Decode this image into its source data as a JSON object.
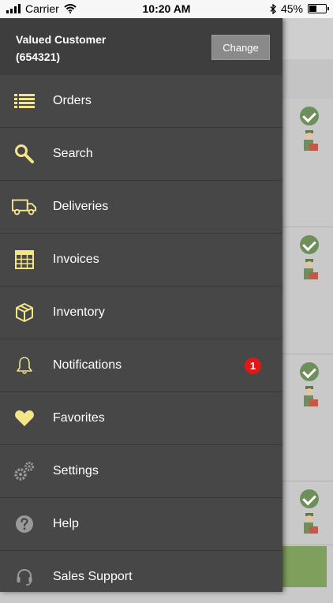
{
  "status_bar": {
    "carrier": "Carrier",
    "time": "10:20 AM",
    "battery": "45%",
    "battery_level": 0.45
  },
  "customer": {
    "name": "Valued Customer",
    "id": "(654321)",
    "change_label": "Change"
  },
  "menu": [
    {
      "label": "Orders",
      "icon": "list-icon"
    },
    {
      "label": "Search",
      "icon": "search-icon"
    },
    {
      "label": "Deliveries",
      "icon": "truck-icon"
    },
    {
      "label": "Invoices",
      "icon": "invoice-grid-icon"
    },
    {
      "label": "Inventory",
      "icon": "box-icon"
    },
    {
      "label": "Notifications",
      "icon": "bell-icon",
      "badge": "1"
    },
    {
      "label": "Favorites",
      "icon": "heart-icon"
    },
    {
      "label": "Settings",
      "icon": "gears-icon"
    },
    {
      "label": "Help",
      "icon": "question-icon"
    },
    {
      "label": "Sales Support",
      "icon": "headset-icon"
    }
  ],
  "colors": {
    "drawer_bg": "#474747",
    "icon_yellow": "#f2e58a",
    "badge_red": "#e31717"
  }
}
